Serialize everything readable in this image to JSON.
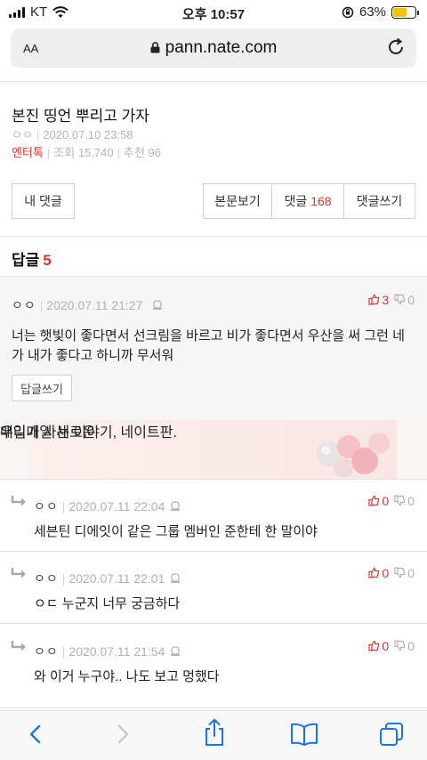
{
  "status_bar": {
    "carrier": "KT",
    "time": "오후 10:57",
    "battery": "63%",
    "battery_level": 0.63
  },
  "address_bar": {
    "aa_label": "AA",
    "url": "pann.nate.com"
  },
  "article": {
    "title": "본진 띵언 뿌리고 가자",
    "author": "ㅇㅇ",
    "datetime": "2020.07.10 23:58",
    "category": "엔터톡",
    "views_label": "조회",
    "views": "15,740",
    "recommend_label": "추천",
    "recommend": "96"
  },
  "buttons": {
    "my_comments": "내 댓글",
    "view_body": "본문보기",
    "comments_label": "댓글",
    "comments_count": "168",
    "write_comment": "댓글쓰기"
  },
  "replies_header": {
    "label": "답글",
    "count": "5"
  },
  "main_comment": {
    "nick": "ㅇㅇ",
    "datetime": "2020.07.11 21:27",
    "up": "3",
    "down": "0",
    "text": "너는 햇빛이 좋다면서 선크림을 바르고 비가 좋다면서 우산을 써 그런 네가 내가 좋다고 하니까 무서워",
    "reply_button": "답글쓰기"
  },
  "banner": {
    "line1": "매일매일 새로운",
    "line2": "우리가 사는 이야기, 네이트판."
  },
  "replies": [
    {
      "nick": "ㅇㅇ",
      "datetime": "2020.07.11 22:04",
      "up": "0",
      "down": "0",
      "text": "세븐틴 디에잇이 같은 그룹 멤버인 준한테 한 말이야"
    },
    {
      "nick": "ㅇㅇ",
      "datetime": "2020.07.11 22:01",
      "up": "0",
      "down": "0",
      "text": "ㅇㄷ 누군지 너무 궁금하다"
    },
    {
      "nick": "ㅇㅇ",
      "datetime": "2020.07.11 21:54",
      "up": "0",
      "down": "0",
      "text": "와 이거 누구야.. 나도 보고 멍했다"
    }
  ],
  "colors": {
    "accent_red": "#e3322d",
    "battery_yellow": "#f3c300",
    "toolbar_blue": "#1a73e8"
  },
  "icons": [
    "signal-icon",
    "wifi-icon",
    "orientation-lock-icon",
    "battery-icon",
    "lock-icon",
    "reload-icon",
    "report-flag-icon",
    "thumbs-up-icon",
    "thumbs-down-icon",
    "reply-arrow-icon",
    "back-icon",
    "forward-icon",
    "share-icon",
    "bookmarks-icon",
    "tabs-icon"
  ]
}
